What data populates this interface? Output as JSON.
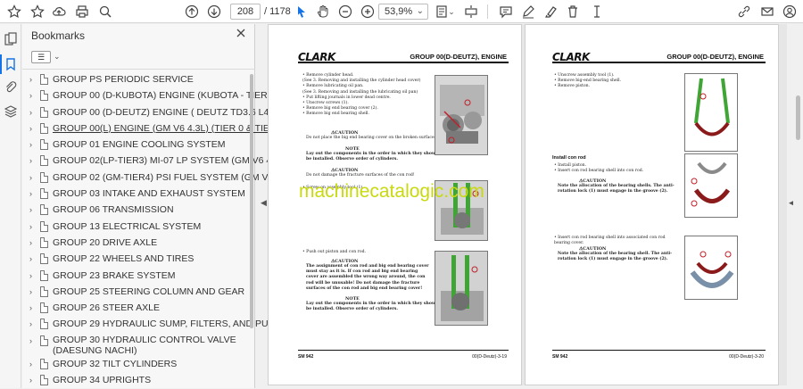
{
  "toolbar": {
    "page_current": "208",
    "page_total": "/ 1178",
    "zoom": "53,9%"
  },
  "sidebar": {
    "title": "Bookmarks",
    "items": [
      {
        "label": "GROUP PS PERIODIC SERVICE"
      },
      {
        "label": "GROUP 00 (D-KUBOTA) ENGINE (KUBOTA - TIER 3)"
      },
      {
        "label": "GROUP 00 (D-DEUTZ) ENGINE ( DEUTZ TD3.6 L4 - TIER 4)"
      },
      {
        "label": "GROUP 00(L) ENGINE (GM V6 4.3L) (TIER 0 & TIER 4)"
      },
      {
        "label": "GROUP 01 ENGINE COOLING SYSTEM"
      },
      {
        "label": "GROUP 02(LP-TIER3) MI-07 LP SYSTEM (GM V6 4.3)"
      },
      {
        "label": "GROUP 02 (GM-TIER4) PSI FUEL SYSTEM (GM V6 4.3)"
      },
      {
        "label": "GROUP 03 INTAKE AND EXHAUST SYSTEM"
      },
      {
        "label": "GROUP 06 TRANSMISSION"
      },
      {
        "label": "GROUP 13 ELECTRICAL SYSTEM"
      },
      {
        "label": "GROUP 20 DRIVE AXLE"
      },
      {
        "label": "GROUP 22 WHEELS AND TIRES"
      },
      {
        "label": "GROUP 23 BRAKE SYSTEM"
      },
      {
        "label": "GROUP 25 STEERING COLUMN AND GEAR"
      },
      {
        "label": "GROUP 26 STEER AXLE"
      },
      {
        "label": "GROUP 29 HYDRAULIC SUMP, FILTERS, AND PUMP"
      },
      {
        "label": "GROUP 30 HYDRAULIC CONTROL VALVE (DAESUNG NACHI)"
      },
      {
        "label": "GROUP 32 TILT CYLINDERS"
      },
      {
        "label": "GROUP 34 UPRIGHTS"
      }
    ]
  },
  "page1": {
    "logo": "CLARK",
    "group": "GROUP 00(D-DEUTZ), ENGINE",
    "steps_a": [
      "• Remove cylinder head.",
      "  (See 3. Removing and installing the cylinder head cover)",
      "• Remove lubricating oil pan.",
      "  (See 3. Removing and installing the lubricating oil pan)",
      "• Put lifting journals in lower dead centre.",
      "• Unscrew screws (1).",
      "• Remove big end bearing cover (2).",
      "• Remove big end bearing shell."
    ],
    "caution1_title": "⚠CAUTION",
    "caution1_text": "Do not place the big end bearing cover on the broken surface.",
    "note1_title": "NOTE",
    "note1_text": "Lay out the components in the order in which they should be installed. Observe order of cylinders.",
    "caution2_title": "⚠CAUTION",
    "caution2_text": "Do not damage the fracture surfaces of the con rod!",
    "step_b": "• Screw on assembly tool (1).",
    "step_c": "• Push out piston and con rod.",
    "caution3_title": "⚠CAUTION",
    "caution3_text": "The assignment of con rod and big end bearing cover must stay as it is. If con rod and big end bearing cover are assembled the wrong way around, the con rod will be unusable! Do not damage the fracture surfaces of the con rod and big end bearing cover!",
    "note2_title": "NOTE",
    "note2_text": "Lay out the components in the order in which they should be installed. Observe order of cylinders.",
    "footer_left": "SM 942",
    "footer_right": "00(D-Deutz)-3-19"
  },
  "page2": {
    "logo": "CLARK",
    "group": "GROUP 00(D-DEUTZ), ENGINE",
    "steps_a": [
      "• Unscrew assembly tool (1).",
      "• Remove big-end bearing shell.",
      "• Remove piston."
    ],
    "install_title": "Install con rod",
    "steps_b": [
      "• Install piston.",
      "• Insert con rod bearing shell into con rod."
    ],
    "caution1_title": "⚠CAUTION",
    "caution1_text": "Note the allocation of the bearing shells. The anti-rotation lock (1) must engage in the groove (2).",
    "step_c": "• Insert con rod bearing shell into associated con rod bearing cover.",
    "caution2_title": "⚠CAUTION",
    "caution2_text": "Note the allocation of the bearing shell. The anti-rotation lock (1) must engage in the groove (2).",
    "footer_left": "SM 942",
    "footer_right": "00(D-Deutz)-3-20"
  },
  "watermark": "machinecatalogic.com"
}
